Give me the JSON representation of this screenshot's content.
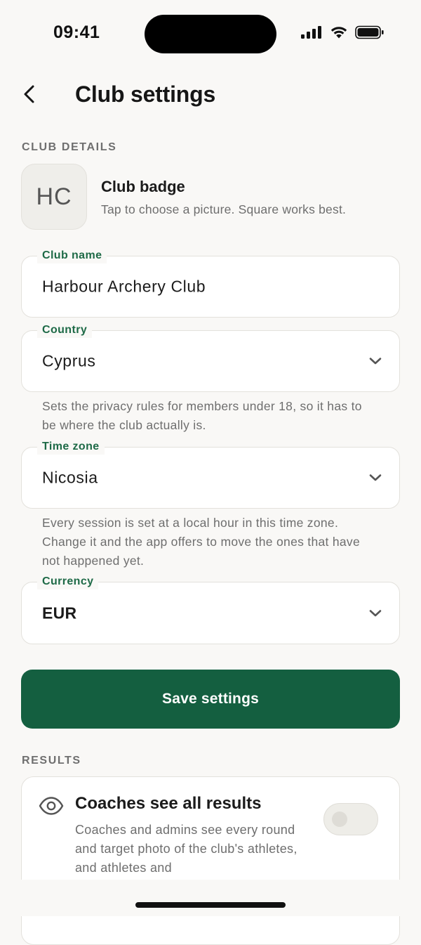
{
  "status_bar": {
    "time": "09:41",
    "icons": [
      "signal-icon",
      "wifi-icon",
      "battery-icon"
    ]
  },
  "header": {
    "title": "Club settings",
    "back_icon": "chevron-left-icon"
  },
  "club_details": {
    "section_label": "CLUB DETAILS",
    "badge": {
      "initials": "HC",
      "title": "Club badge",
      "hint": "Tap to choose a picture. Square works best."
    },
    "club_name": {
      "label": "Club name",
      "value": "Harbour Archery Club"
    },
    "country": {
      "label": "Country",
      "value": "Cyprus",
      "helper": "Sets the privacy rules for members under 18, so it has to be where the club actually is."
    },
    "time_zone": {
      "label": "Time zone",
      "value": "Nicosia",
      "helper": "Every session is set at a local hour in this time zone. Change it and the app offers to move the ones that have not happened yet."
    },
    "currency": {
      "label": "Currency",
      "value": "EUR"
    },
    "save_label": "Save settings"
  },
  "results": {
    "section_label": "RESULTS",
    "coaches_see_all": {
      "title": "Coaches see all results",
      "description": "Coaches and admins see every round and target photo of the club's athletes, and athletes and",
      "enabled": false,
      "icon": "eye-icon"
    }
  },
  "colors": {
    "accent": "#145f40",
    "label_green": "#1e6a47",
    "background": "#f9f8f6"
  }
}
